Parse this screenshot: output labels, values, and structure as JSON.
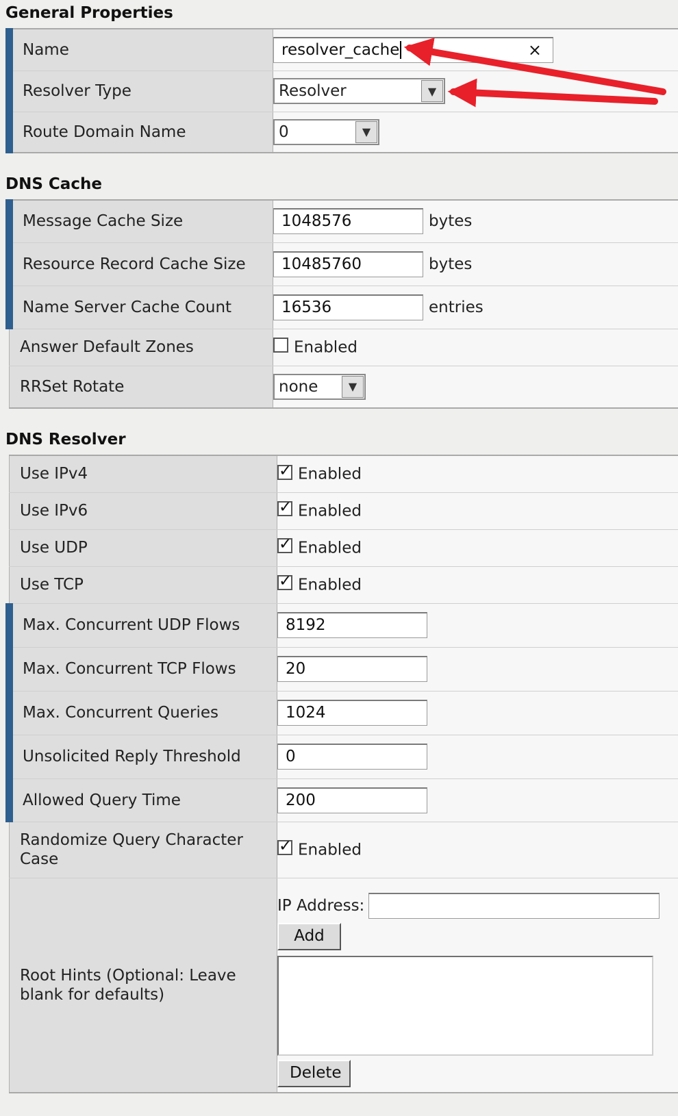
{
  "sections": {
    "general": "General Properties",
    "dns_cache": "DNS Cache",
    "dns_resolver": "DNS Resolver"
  },
  "general": {
    "name_label": "Name",
    "name_value": "resolver_cache",
    "clear_glyph": "×",
    "resolver_type_label": "Resolver Type",
    "resolver_type_value": "Resolver",
    "route_domain_label": "Route Domain Name",
    "route_domain_value": "0"
  },
  "cache": {
    "msg_size_label": "Message Cache Size",
    "msg_size_value": "1048576",
    "msg_size_unit": "bytes",
    "rr_size_label": "Resource Record Cache Size",
    "rr_size_value": "10485760",
    "rr_size_unit": "bytes",
    "ns_count_label": "Name Server Cache Count",
    "ns_count_value": "16536",
    "ns_count_unit": "entries",
    "answer_zones_label": "Answer Default Zones",
    "answer_zones_checked": false,
    "rrset_label": "RRSet Rotate",
    "rrset_value": "none"
  },
  "resolver": {
    "ipv4_label": "Use IPv4",
    "ipv4_checked": true,
    "ipv6_label": "Use IPv6",
    "ipv6_checked": true,
    "udp_label": "Use UDP",
    "udp_checked": true,
    "tcp_label": "Use TCP",
    "tcp_checked": true,
    "max_udp_label": "Max. Concurrent UDP Flows",
    "max_udp_value": "8192",
    "max_tcp_label": "Max. Concurrent TCP Flows",
    "max_tcp_value": "20",
    "max_queries_label": "Max. Concurrent Queries",
    "max_queries_value": "1024",
    "unsolicited_label": "Unsolicited Reply Threshold",
    "unsolicited_value": "0",
    "allowed_time_label": "Allowed Query Time",
    "allowed_time_value": "200",
    "randomize_label": "Randomize Query Character Case",
    "randomize_checked": true,
    "root_hints_label": "Root Hints (Optional: Leave blank for defaults)",
    "ip_address_label": "IP Address:",
    "ip_address_value": "",
    "add_button": "Add",
    "delete_button": "Delete"
  },
  "enabled_text": "Enabled",
  "annotation_color": "#e8202a"
}
